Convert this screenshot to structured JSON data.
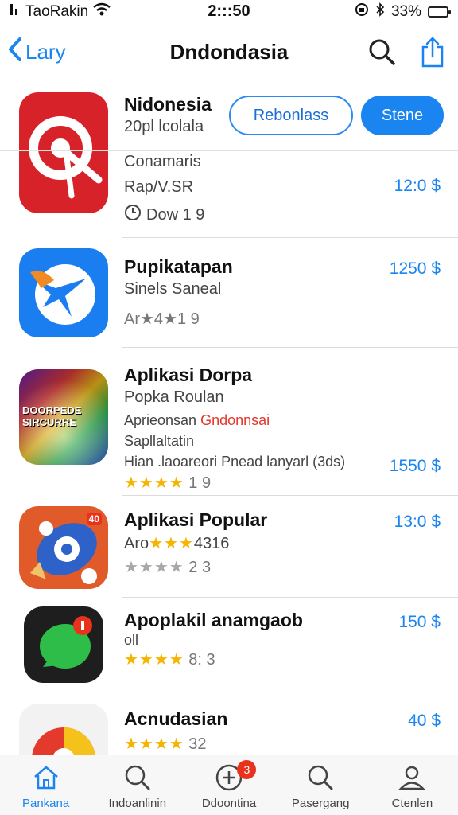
{
  "status": {
    "carrier": "TaoRakin",
    "time": "2:::50",
    "battery": "33%",
    "battery_level": 0.33
  },
  "nav": {
    "back_label": "Lary",
    "title": "Dndondasia"
  },
  "header": {
    "outline_button": "Rebonlass",
    "solid_button": "Stene"
  },
  "apps": [
    {
      "title": "Nidonesia",
      "line1": "20pl lcolala",
      "line2": "Conamaris",
      "line3": "Rap/V.SR",
      "line4": "Dow 1 9",
      "price": "12:0 $"
    },
    {
      "title": "Pupikatapan",
      "line1": "Sinels Saneal",
      "rating_text": "Ar★4★1 9",
      "price": "1250 $"
    },
    {
      "title": "Aplikasi Dorpa",
      "line1": "Popka Roulan",
      "line2_prefix": "Aprieonsan",
      "line2_highlight": "Gndonnsai",
      "line3": "Sapllaltatin",
      "line4": "Hian .laoareori Pnead lanyarl (3ds)",
      "rating": "★★★★",
      "rating_suffix": "1 9",
      "icon_text": "DOORPEDE SIRCURRE",
      "price": "1550 $"
    },
    {
      "title": "Aplikasi Popular",
      "line1_prefix": "Aro",
      "line1_stars": "★★★",
      "line1_suffix": "4316",
      "rating": "★★★★",
      "rating_suffix": "2 3",
      "icon_badge": "40",
      "price": "13:0 $"
    },
    {
      "title": "Apoplakil anamgaob",
      "line1": "oll",
      "rating": "★★★★",
      "rating_suffix": "8: 3",
      "price": "150 $"
    },
    {
      "title": "Acnudasian",
      "rating": "★★★★",
      "rating_suffix": "32",
      "price": "40 $"
    }
  ],
  "tabs": [
    {
      "label": "Pankana",
      "icon": "home-icon"
    },
    {
      "label": "Indoanlinin",
      "icon": "search-icon"
    },
    {
      "label": "Ddoontina",
      "icon": "plus-circle-icon",
      "badge": "3"
    },
    {
      "label": "Pasergang",
      "icon": "search-icon"
    },
    {
      "label": "Ctenlen",
      "icon": "person-icon"
    }
  ],
  "colors": {
    "accent": "#1a84f0",
    "star": "#f4b400",
    "badge": "#e8321c"
  }
}
